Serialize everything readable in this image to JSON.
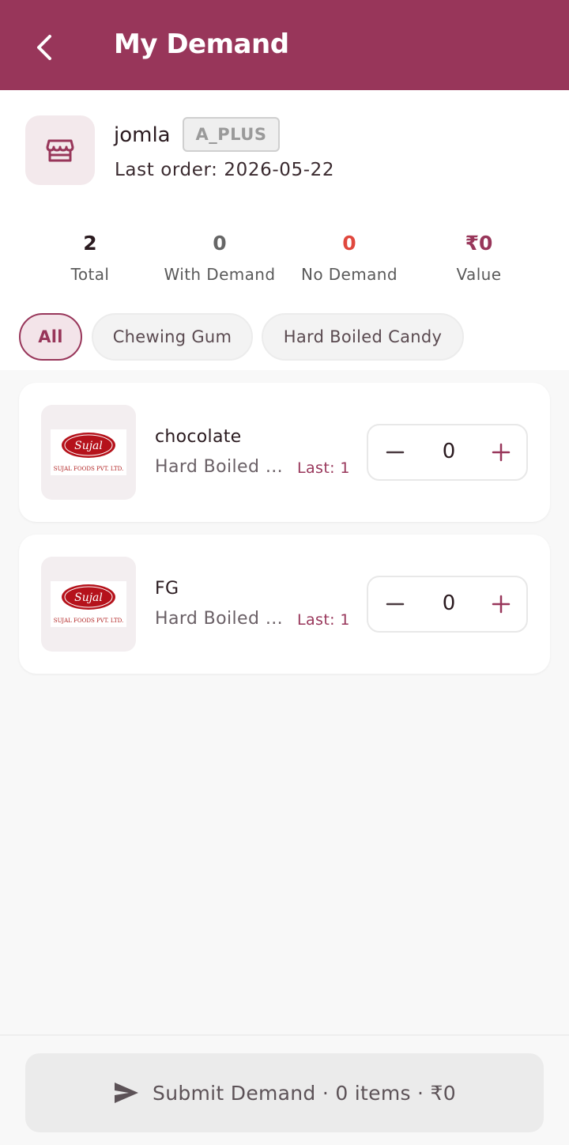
{
  "appbar": {
    "title": "My Demand",
    "back_icon": "chevron-left"
  },
  "retailer": {
    "name": "jomla",
    "tier": "A_PLUS",
    "last_order": "Last order: 2026-05-22",
    "icon": "storefront"
  },
  "stats": [
    {
      "value": "2",
      "label": "Total",
      "color": "#2a1a1f"
    },
    {
      "value": "0",
      "label": "With Demand",
      "color": "#666666"
    },
    {
      "value": "0",
      "label": "No Demand",
      "color": "#e0483e"
    },
    {
      "value": "₹0",
      "label": "Value",
      "color": "#98365a"
    }
  ],
  "filters": [
    {
      "label": "All",
      "active": true
    },
    {
      "label": "Chewing Gum",
      "active": false
    },
    {
      "label": "Hard Boiled Candy",
      "active": false
    }
  ],
  "products": [
    {
      "name": "chocolate",
      "category": "Hard Boiled …",
      "last": "Last: 1",
      "qty": "0",
      "logo_text": "SUJAL FOODS PVT. LTD."
    },
    {
      "name": "FG",
      "category": "Hard Boiled …",
      "last": "Last: 1",
      "qty": "0",
      "logo_text": "SUJAL FOODS PVT. LTD."
    }
  ],
  "submit": {
    "label": "Submit Demand · 0 items · ₹0",
    "icon": "send"
  },
  "colors": {
    "primary": "#98365a",
    "danger": "#e0483e"
  }
}
